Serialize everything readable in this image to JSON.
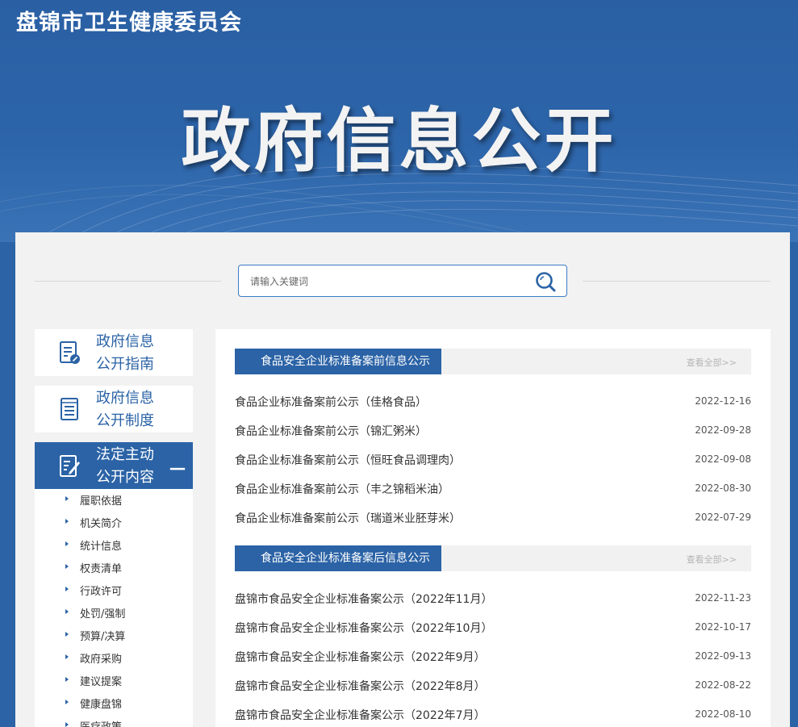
{
  "header": {
    "site_title": "盘锦市卫生健康委员会",
    "hero_title": "政府信息公开"
  },
  "search": {
    "placeholder": "请输入关键词",
    "icon": "search-icon"
  },
  "sidebar": {
    "items": [
      {
        "label_line1": "政府信息",
        "label_line2": "公开指南",
        "icon": "document-pen-icon",
        "active": false
      },
      {
        "label_line1": "政府信息",
        "label_line2": "公开制度",
        "icon": "list-document-icon",
        "active": false
      },
      {
        "label_line1": "法定主动",
        "label_line2": "公开内容",
        "icon": "document-edit-icon",
        "active": true,
        "toggle": "－"
      }
    ],
    "subitems": [
      "履职依据",
      "机关简介",
      "统计信息",
      "权责清单",
      "行政许可",
      "处罚/强制",
      "预算/决算",
      "政府采购",
      "建议提案",
      "健康盘锦",
      "医疗政策"
    ]
  },
  "sections": [
    {
      "title": "食品安全企业标准备案前信息公示",
      "more": "查看全部>>",
      "rows": [
        {
          "title": "食品企业标准备案前公示（佳格食品）",
          "date": "2022-12-16"
        },
        {
          "title": "食品企业标准备案前公示（锦汇粥米）",
          "date": "2022-09-28"
        },
        {
          "title": "食品企业标准备案前公示（恒旺食品调理肉）",
          "date": "2022-09-08"
        },
        {
          "title": "食品企业标准备案前公示（丰之锦稻米油）",
          "date": "2022-08-30"
        },
        {
          "title": "食品企业标准备案前公示（瑞道米业胚芽米）",
          "date": "2022-07-29"
        }
      ]
    },
    {
      "title": "食品安全企业标准备案后信息公示",
      "more": "查看全部>>",
      "rows": [
        {
          "title": "盘锦市食品安全企业标准备案公示（2022年11月）",
          "date": "2022-11-23"
        },
        {
          "title": "盘锦市食品安全企业标准备案公示（2022年10月）",
          "date": "2022-10-17"
        },
        {
          "title": "盘锦市食品安全企业标准备案公示（2022年9月）",
          "date": "2022-09-13"
        },
        {
          "title": "盘锦市食品安全企业标准备案公示（2022年8月）",
          "date": "2022-08-22"
        },
        {
          "title": "盘锦市食品安全企业标准备案公示（2022年7月）",
          "date": "2022-08-10"
        }
      ]
    }
  ],
  "colors": {
    "primary": "#2b63a6",
    "panel_bg": "#f2f2f2",
    "text": "#333333"
  }
}
